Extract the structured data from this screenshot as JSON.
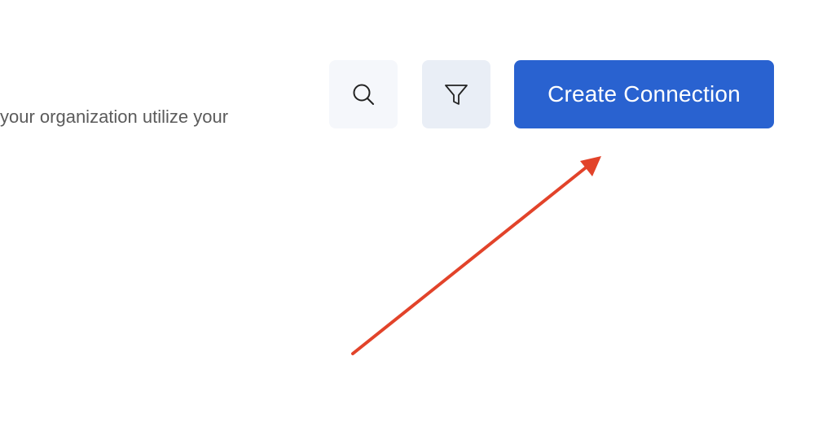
{
  "header": {
    "description": "your organization utilize your"
  },
  "toolbar": {
    "search_icon": "search-icon",
    "filter_icon": "filter-icon",
    "create_label": "Create Connection"
  },
  "annotation": {
    "arrow_color": "#e2432a"
  },
  "colors": {
    "accent": "#2962d0",
    "text_muted": "#5b5b5b"
  }
}
